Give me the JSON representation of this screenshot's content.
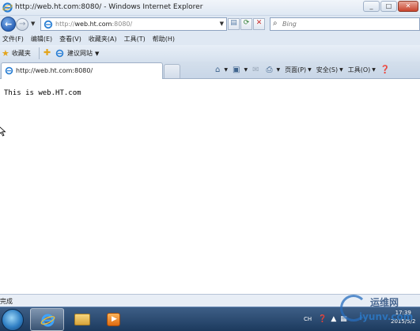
{
  "window": {
    "title": "http://web.ht.com:8080/ - Windows Internet Explorer"
  },
  "address_bar": {
    "url_scheme": "http://",
    "url_domain": "web.ht.com",
    "url_rest": ":8080/"
  },
  "search": {
    "placeholder": "Bing"
  },
  "menu": {
    "items": [
      "文件(F)",
      "编辑(E)",
      "查看(V)",
      "收藏夹(A)",
      "工具(T)",
      "帮助(H)"
    ]
  },
  "favorites_bar": {
    "favorites_label": "收藏夹",
    "suggested_sites": "建议网站"
  },
  "tab": {
    "title": "http://web.ht.com:8080/"
  },
  "command_bar": {
    "page": "页面(P)",
    "safety": "安全(S)",
    "tools": "工具(O)"
  },
  "content": {
    "text": "This is web.HT.com"
  },
  "status_bar": {
    "status": "完成"
  },
  "taskbar": {
    "language": "CH",
    "time": "17:39",
    "date": "2015/5/2"
  },
  "watermark": {
    "line1": "运维网",
    "line2": "iyunv.com"
  },
  "colors": {
    "chrome": "#dfe8f3",
    "taskbar": "#1c3a5e",
    "ie_blue": "#2b63b8",
    "close_red": "#c8432c"
  }
}
